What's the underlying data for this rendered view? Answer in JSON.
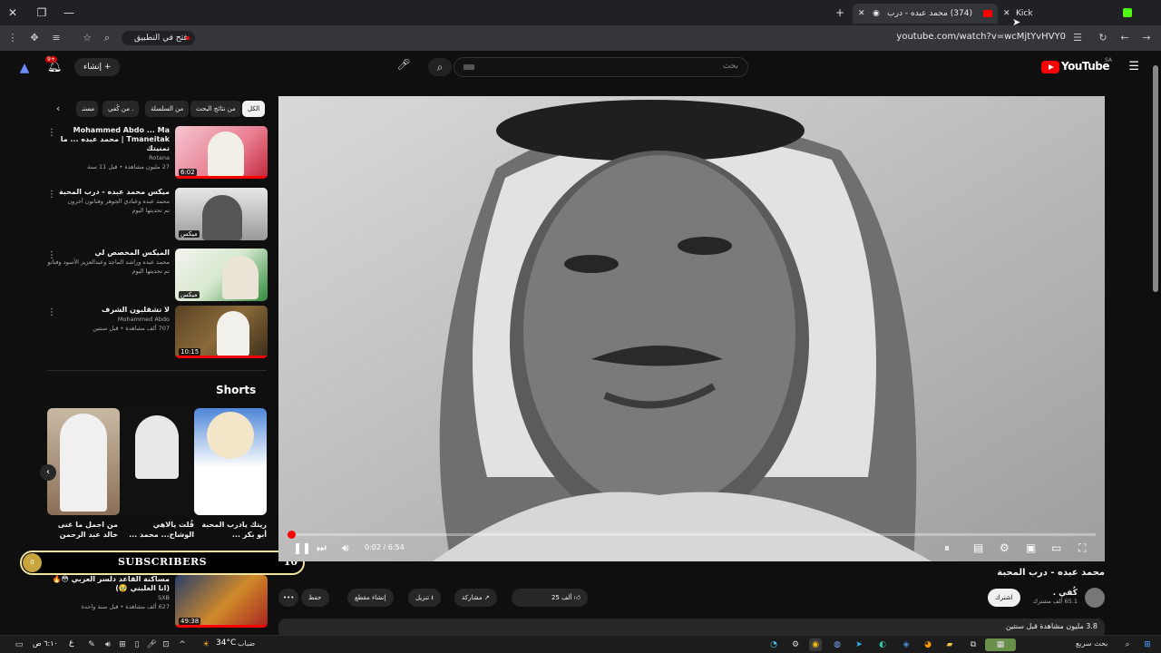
{
  "browser": {
    "tabs": [
      {
        "label": "(374) محمد عبده - درب المحبة",
        "active": true
      },
      {
        "label": "Kick",
        "active": false
      }
    ],
    "url": "youtube.com/watch?v=wcMjtYvHVY0",
    "open_in_app": "فتح في التطبيق"
  },
  "youtube": {
    "logo_text": "YouTube",
    "logo_country": "SA",
    "search_placeholder": "بحث",
    "create_label": "إنشاء",
    "notif_count": "9+"
  },
  "chips": [
    "الكل",
    "من نتائج البحث",
    "من السلسلة",
    "من كُفي .",
    "مستـ"
  ],
  "sidebar_videos": [
    {
      "title": "Mohammed Abdo ... Ma Tmaneitak | محمد عبده ... ما تمنيتك",
      "channel": "Rotana",
      "stats": "27 مليون مشاهدة • قبل 11 سنة",
      "duration": "6:02"
    },
    {
      "title": "ميكس محمد عبده - درب المحبة",
      "channel": "محمد عبده وعبادي الجوهر وفنانون آخرون",
      "stats": "تم تحديثها اليوم",
      "duration": "ميكس"
    },
    {
      "title": "الميكس المخصص لي",
      "channel": "محمد عبده وراشد الماجد وعبدالعزيز الأسود وفنانون آخر...",
      "stats": "تم تحديثها اليوم",
      "duration": "ميكس"
    },
    {
      "title": "لا تشقلبون الشرف",
      "channel": "Mohammed Abdo",
      "stats": "707 ألف مشاهدة • قبل سنتين",
      "duration": "10:15"
    }
  ],
  "shorts": {
    "heading": "Shorts",
    "items": [
      {
        "title": "من اجمل ما غنى خالد عبد الرحمن"
      },
      {
        "title": "قُلت يالاهي الوشاح... محمد ..."
      },
      {
        "title": "ريتك يادرب المحبة أبو بكر ..."
      }
    ]
  },
  "subscribers": {
    "label": "SUBSCRIBERS",
    "count": "10",
    "coin": "0"
  },
  "bottom_video": {
    "title": "مساكنة القاعد دلسر العزبي 😳🔥 (انا الغلبني 🥹)",
    "channel": "SXB",
    "stats": "627 ألف مشاهدة • قبل سنة واحدة",
    "duration": "49:38"
  },
  "player": {
    "time": "0:02 / 6:54",
    "progress": 0.005
  },
  "video": {
    "title": "محمد عبده - درب المحبة",
    "channel_name": "كُفي .",
    "channel_subs": "65.1 ألف مشترك",
    "subscribe": "اشترك",
    "likes": "25 ألف",
    "share": "مشاركة",
    "download": "تنزيل",
    "clip": "إنشاء مقطع",
    "save": "حفظ",
    "views": "3.8 مليون مشاهدة قبل سنتين"
  },
  "taskbar": {
    "search_placeholder": "بحث سريع",
    "weather": "34°C",
    "weather_desc": "ضباب",
    "clock": "٦:١٠ ص",
    "lang": "ع"
  }
}
